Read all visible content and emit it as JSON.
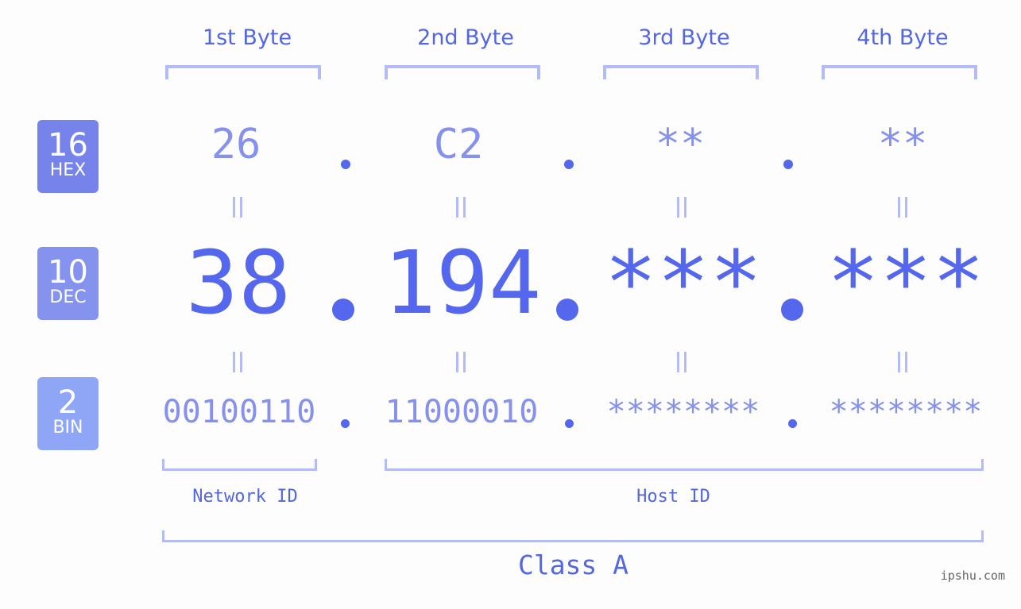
{
  "bytes": [
    {
      "label": "1st Byte",
      "hex": "26",
      "dec": "38",
      "bin": "00100110"
    },
    {
      "label": "2nd Byte",
      "hex": "C2",
      "dec": "194",
      "bin": "11000010"
    },
    {
      "label": "3rd Byte",
      "hex": "**",
      "dec": "***",
      "bin": "********"
    },
    {
      "label": "4th Byte",
      "hex": "**",
      "dec": "***",
      "bin": "********"
    }
  ],
  "badges": {
    "hex": {
      "num": "16",
      "label": "HEX",
      "color": "#7683ea"
    },
    "dec": {
      "num": "10",
      "label": "DEC",
      "color": "#8593ef"
    },
    "bin": {
      "num": "2",
      "label": "BIN",
      "color": "#8fa6f7"
    }
  },
  "segments": {
    "network": "Network ID",
    "host": "Host ID"
  },
  "class_label": "Class A",
  "watermark": "ipshu.com",
  "colors": {
    "accent": "#5567ec",
    "light_value": "#8591ec",
    "bracket": "#b3bcf7"
  }
}
